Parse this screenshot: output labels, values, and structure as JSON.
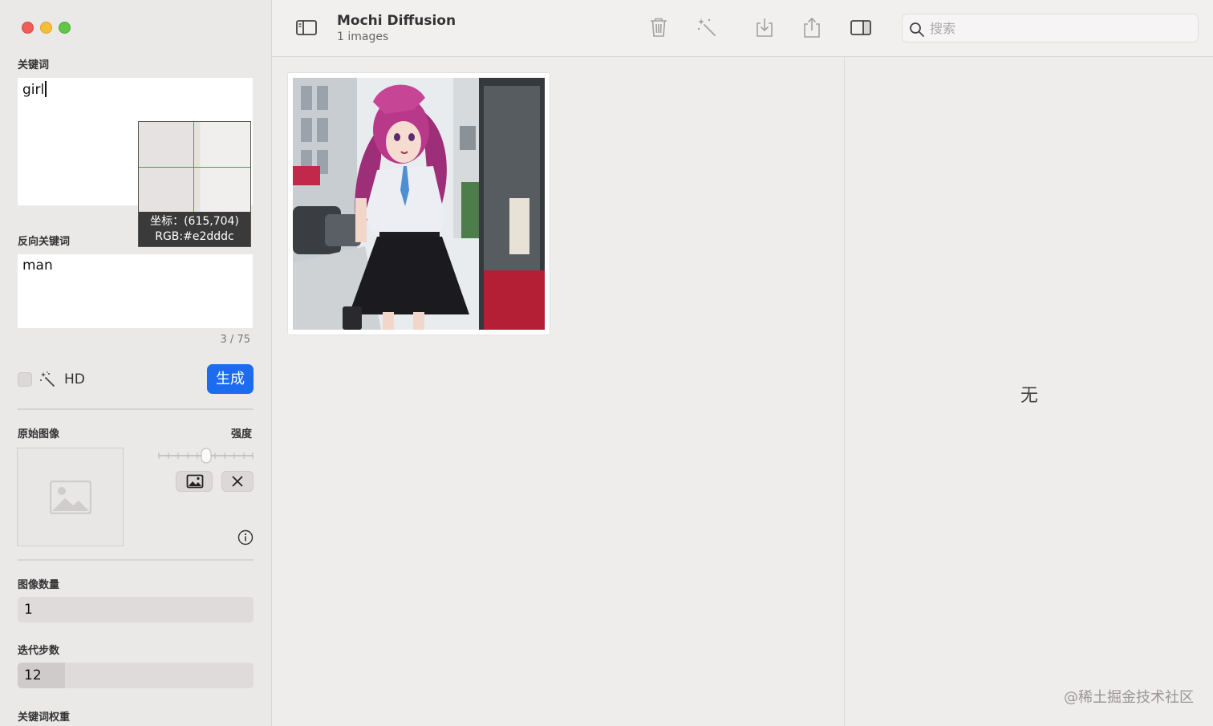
{
  "window": {
    "title": "Mochi Diffusion",
    "subtitle": "1 images"
  },
  "sidebar": {
    "prompt_label": "关键词",
    "prompt_value": "girl",
    "magnifier": {
      "coord_text": "坐标：(615,704)",
      "rgb_text": "RGB:#e2dddc"
    },
    "negative_label": "反向关键词",
    "negative_value": "man",
    "token_counter": "3 / 75",
    "hd_label": "HD",
    "hd_checked": false,
    "generate_label": "生成",
    "source_image_label": "原始图像",
    "strength_label": "强度",
    "strength_value": 0.5,
    "image_count_label": "图像数量",
    "image_count_value": "1",
    "steps_label": "迭代步数",
    "steps_value": "12",
    "steps_fill": 0.2,
    "guidance_label": "关键词权重"
  },
  "toolbar": {
    "icons": [
      "sidebar-toggle-icon",
      "trash-icon",
      "magic-wand-icon",
      "download-icon",
      "share-icon",
      "inspector-toggle-icon"
    ],
    "search_placeholder": "搜索"
  },
  "inspector": {
    "empty_text": "无"
  },
  "watermark": "@稀土掘金技术社区",
  "colors": {
    "accent": "#1d6cf0",
    "sidebar_bg": "#ebe8e8",
    "content_bg": "#efecec",
    "magnifier_crosshair": "#2fb23a"
  }
}
